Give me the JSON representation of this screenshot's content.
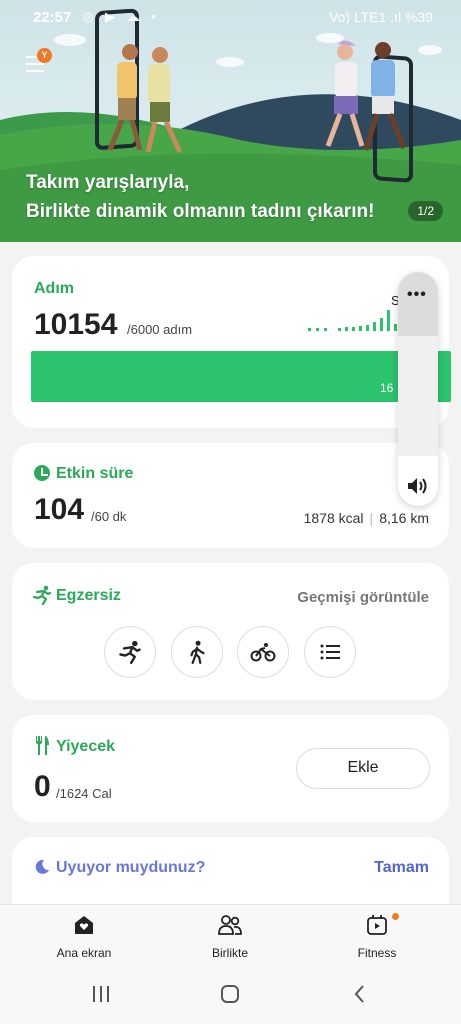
{
  "status_bar": {
    "time": "22:57",
    "left_icons": "◎ ▶ ☁ •",
    "right_text": "Vo) LTE1 .ıl %39"
  },
  "banner": {
    "menu_badge": "Y",
    "title_line1": "Takım yarışlarıyla,",
    "title_line2": "Birlikte dinamik olmanın tadını çıkarın!",
    "page_indicator": "1/2"
  },
  "steps": {
    "title": "Adım",
    "value": "10154",
    "goal": "/6000 adım",
    "bar_label": "16",
    "partial_label": "S",
    "progress_fraction": 1.0
  },
  "active_time": {
    "title": "Etkin süre",
    "value": "104",
    "goal": "/60 dk",
    "kcal": "1878 kcal",
    "distance": "8,16 km"
  },
  "exercise": {
    "title": "Egzersiz",
    "history_link": "Geçmişi görüntüle",
    "buttons": [
      {
        "icon": "running-icon"
      },
      {
        "icon": "walking-icon"
      },
      {
        "icon": "cycling-icon"
      },
      {
        "icon": "list-icon"
      }
    ]
  },
  "food": {
    "title": "Yiyecek",
    "value": "0",
    "goal": "/1624 Cal",
    "add_label": "Ekle"
  },
  "sleep": {
    "title": "Uyuyor muydunuz?",
    "action": "Tamam"
  },
  "volume_panel": {
    "more_label": "•••"
  },
  "bottom_nav": {
    "home_label": "Ana ekran",
    "together_label": "Birlikte",
    "fitness_label": "Fitness"
  },
  "colors": {
    "accent_green": "#2aaa57",
    "bar_green": "#2bc36b",
    "sleep_blue": "#5366d0",
    "badge_orange": "#f07a23"
  }
}
